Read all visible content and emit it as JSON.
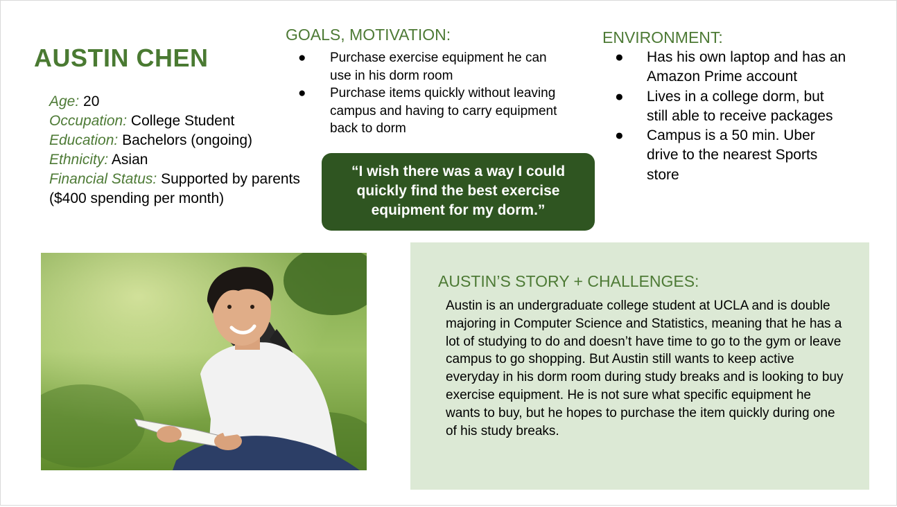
{
  "persona": {
    "name": "AUSTIN CHEN",
    "facts": [
      {
        "label": "Age:",
        "value": " 20"
      },
      {
        "label": "Occupation:",
        "value": "College Student"
      },
      {
        "label": "Education:",
        "value": "Bachelors (ongoing)"
      },
      {
        "label": "Ethnicity:",
        "value": "Asian"
      },
      {
        "label": "Financial Status:",
        "value": "Supported by parents ($400 spending per month)"
      }
    ]
  },
  "goals": {
    "heading": "GOALS, MOTIVATION:",
    "items": [
      "Purchase exercise equipment he can use in his dorm room",
      "Purchase items quickly without leaving campus and having to carry equipment back to dorm"
    ]
  },
  "environment": {
    "heading": "ENVIRONMENT:",
    "items": [
      "Has his own laptop and has an Amazon Prime account",
      "Lives in a college dorm, but still able to receive packages",
      "Campus is a 50 min. Uber drive to the nearest Sports store"
    ]
  },
  "quote": "“I wish there was a way I could quickly find the best exercise equipment for my dorm.”",
  "story": {
    "heading": "AUSTIN’S STORY + CHALLENGES:",
    "text": "Austin is an undergraduate college student at UCLA and is double majoring in Computer Science and Statistics, meaning that he has a lot of studying to do and doesn’t have time to go to the gym or leave campus to go shopping. But Austin still wants to keep active everyday in his dorm room during study breaks and is looking to buy exercise equipment. He is not sure what specific equipment he wants to buy, but he hopes to purchase the item quickly during one of his study breaks."
  },
  "bullet_glyph": "●",
  "colors": {
    "accent_green": "#4d7a35",
    "quote_bg": "#2f5521",
    "story_bg": "#dce9d5"
  }
}
